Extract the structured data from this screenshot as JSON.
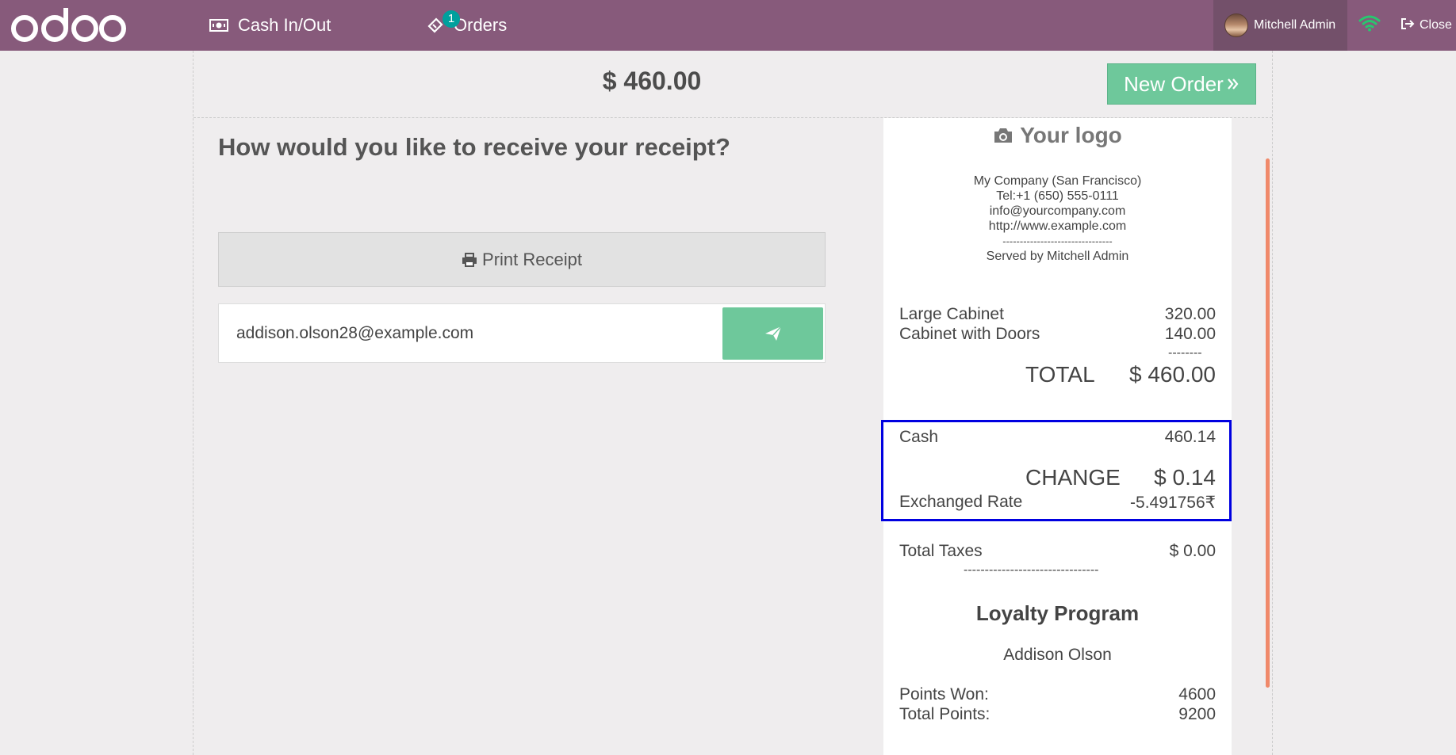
{
  "topbar": {
    "logo_text": "odoo",
    "cash_label": "Cash In/Out",
    "orders_label": "Orders",
    "orders_badge": "1",
    "user_name": "Mitchell Admin",
    "close_label": "Close",
    "bg_color": "#875a7b"
  },
  "payment": {
    "total": "$ 460.00",
    "new_order_label": "New Order",
    "question": "How would you like to receive your receipt?",
    "print_label": "Print Receipt",
    "email_value": "addison.olson28@example.com"
  },
  "receipt": {
    "logo_text": "Your logo",
    "company": "My Company (San Francisco)",
    "tel": "Tel:+1 (650) 555-0111",
    "email": "info@yourcompany.com",
    "website": "http://www.example.com",
    "separator": "--------------------------------",
    "served_by": "Served by Mitchell Admin",
    "lines": [
      {
        "name": "Large Cabinet",
        "price": "320.00"
      },
      {
        "name": "Cabinet with Doors",
        "price": "140.00"
      }
    ],
    "subtotal_dashes": "--------",
    "total_label": "TOTAL",
    "total_value": "$ 460.00",
    "payment_method": "Cash",
    "payment_amount": "460.14",
    "change_label": "CHANGE",
    "change_value": "$ 0.14",
    "exchanged_rate_label": "Exchanged Rate",
    "exchanged_rate_value": "-5.491756₹",
    "taxes_label": "Total Taxes",
    "taxes_value": "$ 0.00",
    "taxes_separator": "--------------------------------",
    "loyalty_title": "Loyalty Program",
    "loyalty_customer": "Addison Olson",
    "points_won_label": "Points Won:",
    "points_won_value": "4600",
    "total_points_label": "Total Points:",
    "total_points_value": "9200"
  },
  "colors": {
    "accent_green": "#6ec89b",
    "highlight_border": "#0000e0",
    "scrollbar": "#f0896a"
  }
}
